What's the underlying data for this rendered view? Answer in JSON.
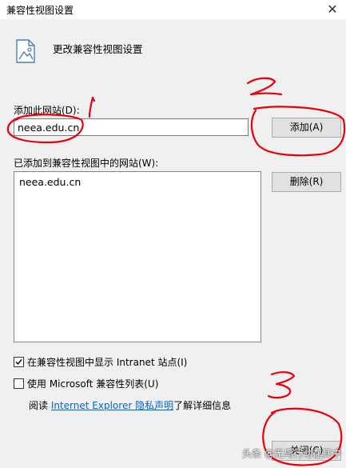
{
  "window": {
    "title": "兼容性视图设置",
    "close_glyph": "✕"
  },
  "header": {
    "text": "更改兼容性视图设置",
    "icon": "document-image-icon"
  },
  "add_site": {
    "label": "添加此网站(D):",
    "value": "neea.edu.cn",
    "button_label": "添加(A)"
  },
  "site_list": {
    "label": "已添加到兼容性视图中的网站(W):",
    "items": [
      "neea.edu.cn"
    ],
    "remove_label": "删除(R)"
  },
  "options": {
    "intranet": {
      "label": "在兼容性视图中显示 Intranet 站点(I)",
      "checked": true
    },
    "ms_list": {
      "label": "使用 Microsoft 兼容性列表(U)",
      "checked": false
    }
  },
  "privacy": {
    "prefix": "阅读 ",
    "link_text": "Internet Explorer 隐私声明",
    "suffix": "了解详细信息"
  },
  "footer": {
    "close_label": "关闭(C)"
  },
  "watermark": "头条 @无鸟行动在其中",
  "colors": {
    "annotation_red": "#e8000b",
    "link_blue": "#0066cc"
  }
}
